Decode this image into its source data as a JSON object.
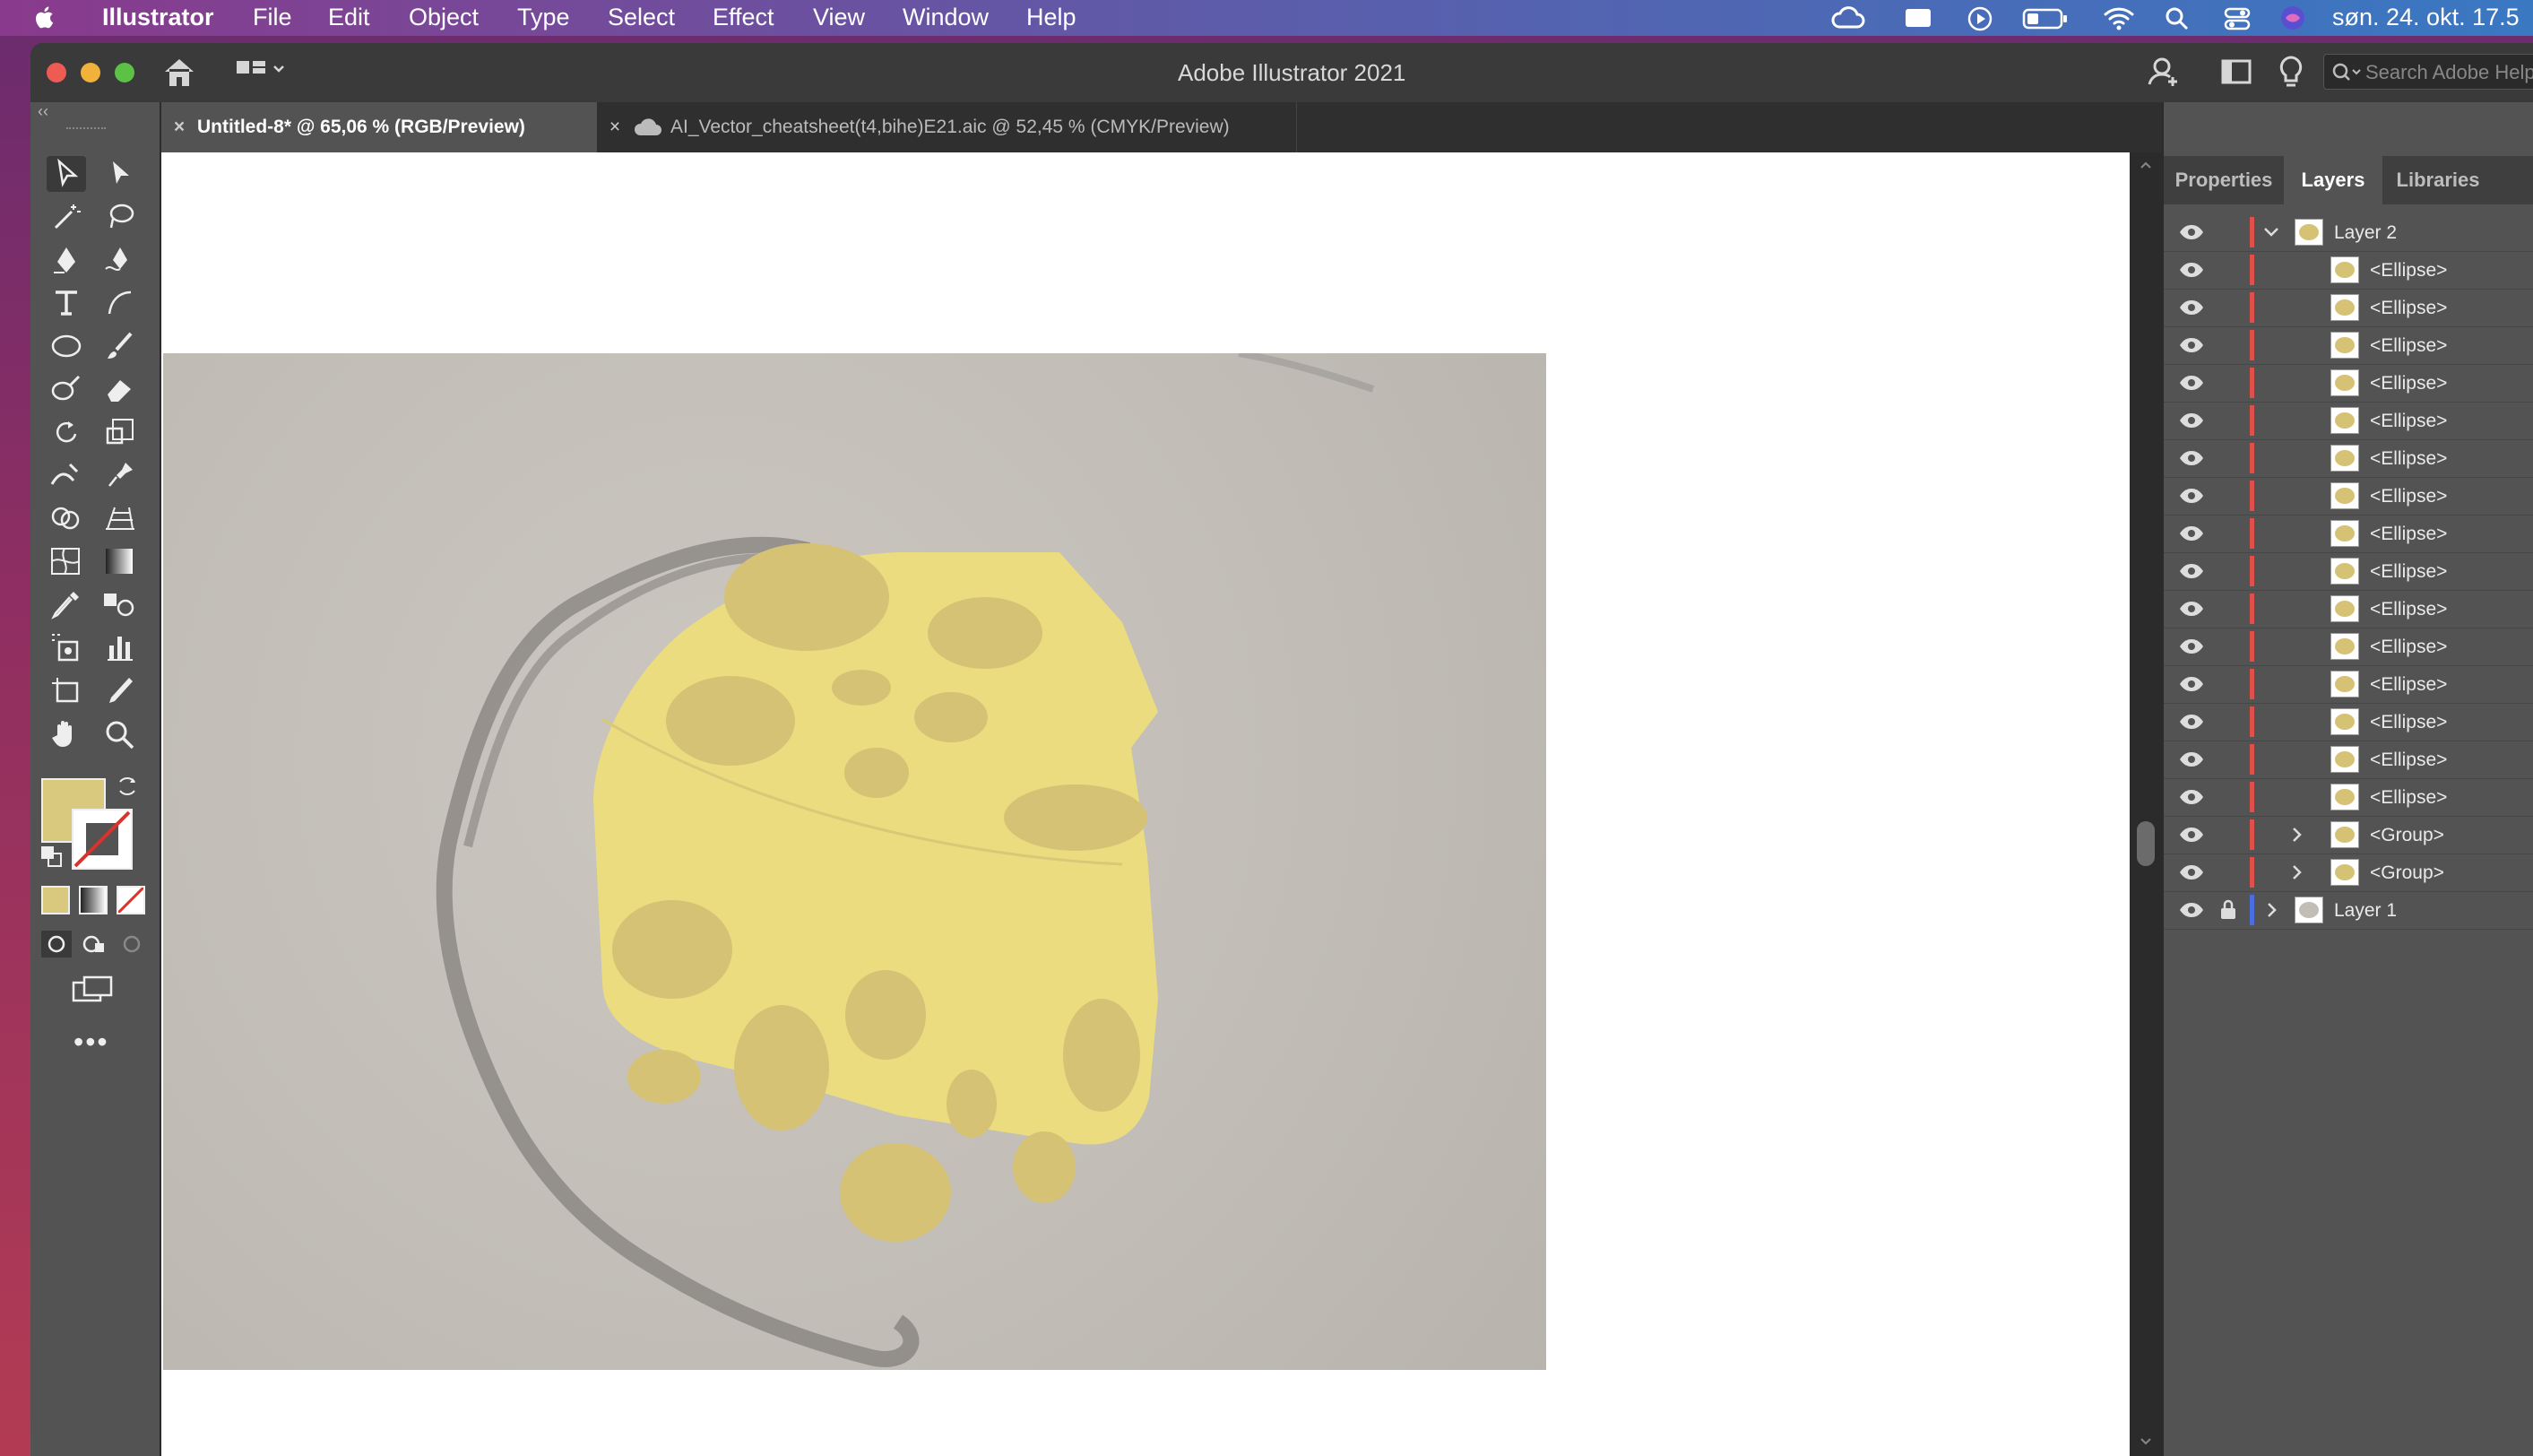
{
  "menubar": {
    "app_name": "Illustrator",
    "items": [
      "File",
      "Edit",
      "Object",
      "Type",
      "Select",
      "Effect",
      "View",
      "Window",
      "Help"
    ],
    "clock": "søn. 24. okt. 17.5"
  },
  "window": {
    "title": "Adobe Illustrator 2021",
    "search_placeholder": "Search Adobe Help"
  },
  "tabs": [
    {
      "label": "Untitled-8* @ 65,06 % (RGB/Preview)"
    },
    {
      "label": "AI_Vector_cheatsheet(t4,bihe)E21.aic @ 52,45 % (CMYK/Preview)"
    }
  ],
  "panel": {
    "tabs": [
      "Properties",
      "Layers",
      "Libraries"
    ],
    "active_tab": "Layers"
  },
  "layers": [
    {
      "name": "Layer 2"
    },
    {
      "name": "<Ellipse>"
    },
    {
      "name": "<Ellipse>"
    },
    {
      "name": "<Ellipse>"
    },
    {
      "name": "<Ellipse>"
    },
    {
      "name": "<Ellipse>"
    },
    {
      "name": "<Ellipse>"
    },
    {
      "name": "<Ellipse>"
    },
    {
      "name": "<Ellipse>"
    },
    {
      "name": "<Ellipse>"
    },
    {
      "name": "<Ellipse>"
    },
    {
      "name": "<Ellipse>"
    },
    {
      "name": "<Ellipse>"
    },
    {
      "name": "<Ellipse>"
    },
    {
      "name": "<Ellipse>"
    },
    {
      "name": "<Ellipse>"
    },
    {
      "name": "<Group>"
    },
    {
      "name": "<Group>"
    },
    {
      "name": "Layer 1"
    }
  ],
  "colors": {
    "fill_swatch": "#d8c97f",
    "cheese": "#ebdc7f",
    "holes": "#d6c274",
    "layer2_color": "#e0504a",
    "layer1_color": "#4a6ee0"
  }
}
